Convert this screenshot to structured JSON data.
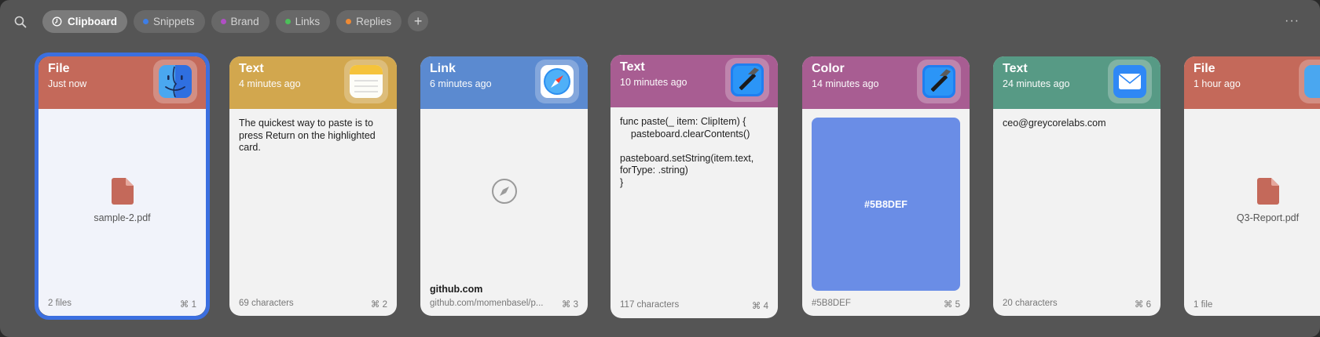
{
  "toolbar": {
    "tabs": [
      {
        "label": "Clipboard",
        "active": true
      },
      {
        "label": "Snippets",
        "dot": "#3e7ee6"
      },
      {
        "label": "Brand",
        "dot": "#b04fc4"
      },
      {
        "label": "Links",
        "dot": "#4cbf5a"
      },
      {
        "label": "Replies",
        "dot": "#ef8a34"
      }
    ],
    "add_label": "+",
    "more_label": "···"
  },
  "cards": [
    {
      "type": "File",
      "time": "Just now",
      "file_name": "sample-2.pdf",
      "footer_left": "2 files",
      "footer_right": "⌘ 1",
      "head_color": "#c4695a",
      "app": "finder-icon"
    },
    {
      "type": "Text",
      "time": "4 minutes ago",
      "text": "The quickest way to paste is to press Return on the highlighted card.",
      "footer_left": "69 characters",
      "footer_right": "⌘ 2",
      "head_color": "#d2a74e",
      "app": "notes-icon"
    },
    {
      "type": "Link",
      "time": "6 minutes ago",
      "link_title": "github.com",
      "footer_left": "github.com/momenbasel/p...",
      "footer_right": "⌘ 3",
      "head_color": "#5b8ad0",
      "app": "safari-icon"
    },
    {
      "type": "Text",
      "time": "10 minutes ago",
      "code": "func paste(_ item: ClipItem) {\n    pasteboard.clearContents()\n\npasteboard.setString(item.text,\nforType: .string)\n}",
      "footer_left": "117 characters",
      "footer_right": "⌘ 4",
      "head_color": "#a85d92",
      "app": "xcode-icon"
    },
    {
      "type": "Color",
      "time": "14 minutes ago",
      "swatch_label": "#5B8DEF",
      "swatch_color": "#6a8de6",
      "footer_left": "#5B8DEF",
      "footer_right": "⌘ 5",
      "head_color": "#a85d92",
      "app": "xcode-icon"
    },
    {
      "type": "Text",
      "time": "24 minutes ago",
      "text": "ceo@greycorelabs.com",
      "footer_left": "20 characters",
      "footer_right": "⌘ 6",
      "head_color": "#579a85",
      "app": "mail-icon"
    },
    {
      "type": "File",
      "time": "1 hour ago",
      "file_name": "Q3-Report.pdf",
      "footer_left": "1 file",
      "footer_right": "",
      "head_color": "#c4695a",
      "app": "finder-icon"
    }
  ]
}
